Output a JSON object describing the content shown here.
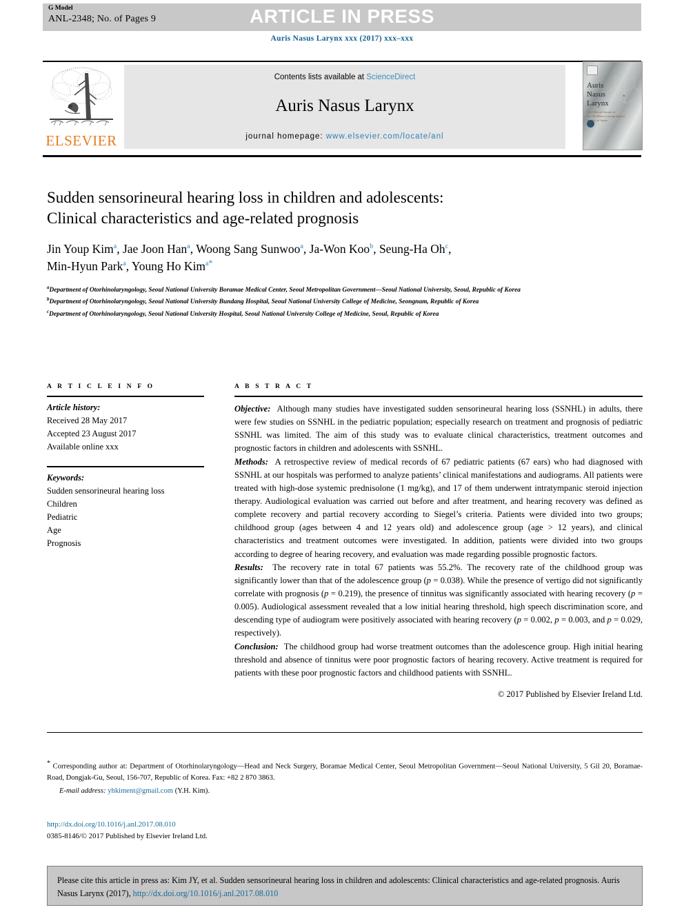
{
  "banner": {
    "g_model": "G Model",
    "manuscript_id": "ANL-2348; No. of Pages 9",
    "status": "ARTICLE IN PRESS"
  },
  "journal_ref": "Auris Nasus Larynx xxx (2017) xxx–xxx",
  "masthead": {
    "publisher": "ELSEVIER",
    "contents_prefix": "Contents lists available at ",
    "contents_link": "ScienceDirect",
    "journal_name": "Auris Nasus Larynx",
    "homepage_prefix": "journal homepage: ",
    "homepage_url": "www.elsevier.com/locate/anl",
    "cover_title": "Auris\nNasus\nLarynx",
    "cover_subtitle": "The Official Journal of\nthe Oto-Rhino-Laryngological\nSociety of Japan"
  },
  "article": {
    "title_line1": "Sudden sensorineural hearing loss in children and adolescents:",
    "title_line2": "Clinical characteristics and age-related prognosis",
    "authors": [
      {
        "name": "Jin Youp Kim",
        "mark": "a",
        "sep": ", "
      },
      {
        "name": "Jae Joon Han",
        "mark": "a",
        "sep": ", "
      },
      {
        "name": "Woong Sang Sunwoo",
        "mark": "a",
        "sep": ", "
      },
      {
        "name": "Ja-Won Koo",
        "mark": "b",
        "sep": ", "
      },
      {
        "name": "Seung-Ha Oh",
        "mark": "c",
        "sep": ", "
      },
      {
        "name": "Min-Hyun Park",
        "mark": "a",
        "sep": ", "
      },
      {
        "name": "Young Ho Kim",
        "mark": "a",
        "corresponding": "*",
        "sep": ""
      }
    ],
    "affiliations": [
      {
        "mark": "a",
        "text": "Department of Otorhinolaryngology, Seoul National University Boramae Medical Center, Seoul Metropolitan Government—Seoul National University, Seoul, Republic of Korea"
      },
      {
        "mark": "b",
        "text": "Department of Otorhinolaryngology, Seoul National University Bundang Hospital, Seoul National University College of Medicine, Seongnam, Republic of Korea"
      },
      {
        "mark": "c",
        "text": "Department of Otorhinolaryngology, Seoul National University Hospital, Seoul National University College of Medicine, Seoul, Republic of Korea"
      }
    ]
  },
  "article_info": {
    "heading": "A R T I C L E   I N F O",
    "history_label": "Article history:",
    "history": [
      "Received 28 May 2017",
      "Accepted 23 August 2017",
      "Available online xxx"
    ],
    "keywords_label": "Keywords:",
    "keywords": [
      "Sudden sensorineural hearing loss",
      "Children",
      "Pediatric",
      "Age",
      "Prognosis"
    ]
  },
  "abstract": {
    "heading": "A B S T R A C T",
    "objective_label": "Objective:",
    "objective_text": "Although many studies have investigated sudden sensorineural hearing loss (SSNHL) in adults, there were few studies on SSNHL in the pediatric population; especially research on treatment and prognosis of pediatric SSNHL was limited. The aim of this study was to evaluate clinical characteristics, treatment outcomes and prognostic factors in children and adolescents with SSNHL.",
    "methods_label": "Methods:",
    "methods_text": "A retrospective review of medical records of 67 pediatric patients (67 ears) who had diagnosed with SSNHL at our hospitals was performed to analyze patients’ clinical manifestations and audiograms. All patients were treated with high-dose systemic prednisolone (1 mg/kg), and 17 of them underwent intratympanic steroid injection therapy. Audiological evaluation was carried out before and after treatment, and hearing recovery was defined as complete recovery and partial recovery according to Siegel’s criteria. Patients were divided into two groups; childhood group (ages between 4 and 12 years old) and adolescence group (age > 12 years), and clinical characteristics and treatment outcomes were investigated. In addition, patients were divided into two groups according to degree of hearing recovery, and evaluation was made regarding possible prognostic factors.",
    "results_label": "Results:",
    "results_text_1": "The recovery rate in total 67 patients was 55.2%. The recovery rate of the childhood group was significantly lower than that of the adolescence group (",
    "results_p1": "p",
    "results_p1_val": " = 0.038). While the presence of vertigo did not significantly correlate with prognosis (",
    "results_p2": "p",
    "results_p2_val": " = 0.219), the presence of tinnitus was significantly associated with hearing recovery (",
    "results_p3": "p",
    "results_p3_val": " = 0.005). Audiological assessment revealed that a low initial hearing threshold, high speech discrimination score, and descending type of audiogram were positively associated with hearing recovery (",
    "results_p4": "p",
    "results_p4_val": " = 0.002, ",
    "results_p5": "p",
    "results_p5_val": " = 0.003, and ",
    "results_p6": "p",
    "results_p6_val": " = 0.029, respectively).",
    "conclusion_label": "Conclusion:",
    "conclusion_text": "The childhood group had worse treatment outcomes than the adolescence group. High initial hearing threshold and absence of tinnitus were poor prognostic factors of hearing recovery. Active treatment is required for patients with these poor prognostic factors and childhood patients with SSNHL.",
    "copyright": "© 2017 Published by Elsevier Ireland Ltd."
  },
  "footnotes": {
    "corresponding": "Corresponding author at: Department of Otorhinolaryngology—Head and Neck Surgery, Boramae Medical Center, Seoul Metropolitan Government—Seoul National University, 5 Gil 20, Boramae-Road, Dongjak-Gu, Seoul, 156-707, Republic of Korea. Fax: +82 2 870 3863.",
    "email_label": "E-mail address:",
    "email": "yhkiment@gmail.com",
    "email_owner": "(Y.H. Kim).",
    "doi_url": "http://dx.doi.org/10.1016/j.anl.2017.08.010",
    "issn_line": "0385-8146/© 2017 Published by Elsevier Ireland Ltd."
  },
  "citation_box": {
    "text": "Please cite this article in press as: Kim JY, et al. Sudden sensorineural hearing loss in children and adolescents: Clinical characteristics and age-related prognosis. Auris Nasus Larynx (2017), ",
    "link": "http://dx.doi.org/10.1016/j.anl.2017.08.010"
  },
  "colors": {
    "banner_gray": "#c8c8c8",
    "journal_blue": "#13618f",
    "link_blue": "#17699b",
    "elsevier_orange": "#e87d1e",
    "masthead_gray": "#e6e6e6",
    "cite_box_gray": "#c7c7c7"
  }
}
